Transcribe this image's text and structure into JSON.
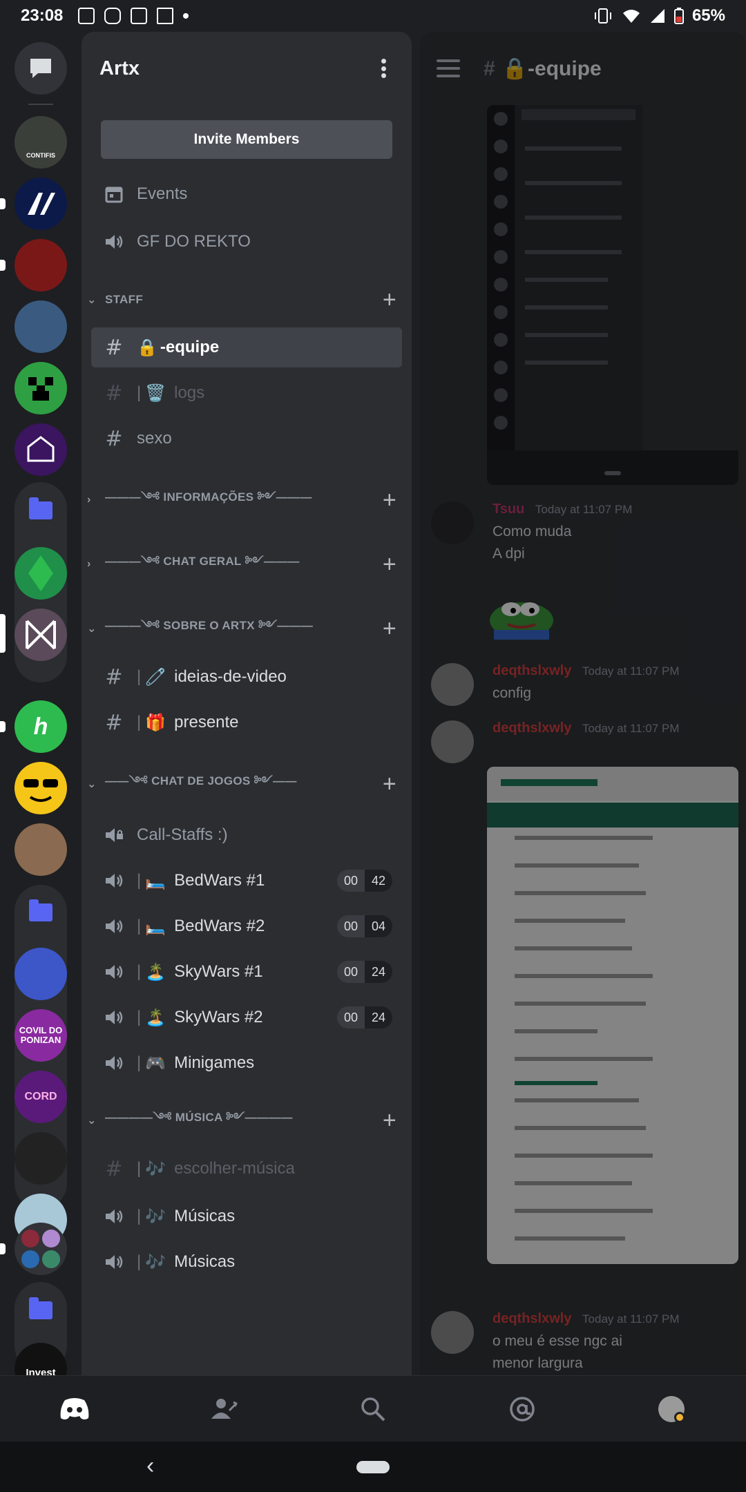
{
  "status_bar": {
    "time": "23:08",
    "battery": "65%"
  },
  "guild": {
    "name": "Artx",
    "invite_label": "Invite Members"
  },
  "top_items": [
    {
      "icon": "calendar-icon",
      "label": "Events"
    },
    {
      "icon": "speaker-icon",
      "label": "GF DO REKTO"
    }
  ],
  "categories": {
    "staff": "STAFF",
    "informacoes": "———༺ INFORMAÇÕES ༻———",
    "chat_geral": "———༺ CHAT GERAL ༻———",
    "sobre": "———༺ SOBRE O ARTX ༻———",
    "jogos": "——༺ CHAT DE JOGOS ༻——",
    "musica": "————༺ MÚSICA ༻————"
  },
  "channels": {
    "equipe": {
      "emoji": "🔒",
      "name": "-equipe"
    },
    "logs": {
      "emoji": "🗑️",
      "name": "logs"
    },
    "sexo": {
      "name": "sexo"
    },
    "ideias": {
      "emoji": "🧷",
      "name": "ideias-de-video"
    },
    "presente": {
      "emoji": "🎁",
      "name": "presente"
    },
    "call_staffs": {
      "name": "Call-Staffs :)"
    },
    "bedwars1": {
      "emoji": "🛏️",
      "name": "BedWars #1",
      "count_a": "00",
      "count_b": "42"
    },
    "bedwars2": {
      "emoji": "🛏️",
      "name": "BedWars #2",
      "count_a": "00",
      "count_b": "04"
    },
    "skywars1": {
      "emoji": "🏝️",
      "name": "SkyWars #1",
      "count_a": "00",
      "count_b": "24"
    },
    "skywars2": {
      "emoji": "🏝️",
      "name": "SkyWars #2",
      "count_a": "00",
      "count_b": "24"
    },
    "minigames": {
      "emoji": "🎮",
      "name": "Minigames"
    },
    "escolher": {
      "emoji": "🎶",
      "name": "escolher-música"
    },
    "musicas1": {
      "emoji": "🎶",
      "name": "Músicas"
    },
    "musicas2": {
      "emoji": "🎶",
      "name": "Músicas"
    }
  },
  "chat": {
    "title_emoji": "🔒",
    "title": "-equipe",
    "messages": [
      {
        "user": "Tsuu",
        "user_color": "#c13a6a",
        "time": "Today at 11:07 PM",
        "lines": [
          "Como muda",
          "A dpi"
        ]
      },
      {
        "user": "deqthslxwly",
        "user_color": "#d94040",
        "time": "Today at 11:07 PM",
        "lines": [
          "config"
        ]
      },
      {
        "user": "deqthslxwly",
        "user_color": "#d94040",
        "time": "Today at 11:07 PM",
        "lines": []
      },
      {
        "user": "deqthslxwly",
        "user_color": "#d94040",
        "time": "Today at 11:07 PM",
        "lines": [
          "o meu é esse ngc ai",
          "menor largura"
        ]
      }
    ]
  },
  "servers": [
    {
      "label": "CONTIFIS",
      "color": "#3b3f3a"
    },
    {
      "label": "",
      "color": "#0c1a4a"
    },
    {
      "label": "",
      "color": "#7a1818"
    },
    {
      "label": "",
      "color": "#3a5a80"
    },
    {
      "label": "",
      "color": "#2ea043"
    },
    {
      "label": "",
      "color": "#3b1560"
    },
    {
      "label": "",
      "color": "#1f8f4a"
    },
    {
      "label": "",
      "color": "#5a4a5a"
    },
    {
      "label": "h",
      "color": "#2dbb4f"
    },
    {
      "label": "",
      "color": "#f5c518"
    },
    {
      "label": "",
      "color": "#8a6a50"
    },
    {
      "label": "",
      "color": "#3d57c9"
    },
    {
      "label": "COVIL DO PONIZAN",
      "color": "#8a2aa0"
    },
    {
      "label": "CORD",
      "color": "#5a1a7a"
    },
    {
      "label": "",
      "color": "#222"
    },
    {
      "label": "",
      "color": "#a8c8d8"
    },
    {
      "label": "Invest Support",
      "color": "#111"
    }
  ],
  "nav": [
    "home-icon",
    "friends-icon",
    "search-icon",
    "mentions-icon",
    "profile-avatar"
  ]
}
